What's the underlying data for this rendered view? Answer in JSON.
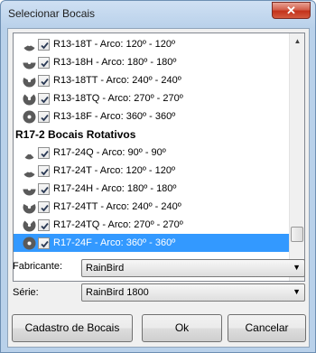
{
  "window": {
    "title": "Selecionar Bocais",
    "close_symbol": "✕"
  },
  "list": {
    "rows": [
      {
        "kind": "nozzle",
        "label": "R13-18T - Arco: 120º - 120º",
        "checked": true,
        "icon": "nozzle-120-icon"
      },
      {
        "kind": "nozzle",
        "label": "R13-18H - Arco: 180º - 180º",
        "checked": true,
        "icon": "nozzle-180-icon"
      },
      {
        "kind": "nozzle",
        "label": "R13-18TT - Arco: 240º - 240º",
        "checked": true,
        "icon": "nozzle-240-icon"
      },
      {
        "kind": "nozzle",
        "label": "R13-18TQ - Arco: 270º - 270º",
        "checked": true,
        "icon": "nozzle-270-icon"
      },
      {
        "kind": "nozzle",
        "label": "R13-18F - Arco: 360º - 360º",
        "checked": true,
        "icon": "nozzle-360-icon"
      },
      {
        "kind": "header",
        "label": "R17-2 Bocais Rotativos"
      },
      {
        "kind": "nozzle",
        "label": "R17-24Q - Arco: 90º - 90º",
        "checked": true,
        "icon": "nozzle-90-icon"
      },
      {
        "kind": "nozzle",
        "label": "R17-24T - Arco: 120º - 120º",
        "checked": true,
        "icon": "nozzle-120-icon"
      },
      {
        "kind": "nozzle",
        "label": "R17-24H - Arco: 180º - 180º",
        "checked": true,
        "icon": "nozzle-180-icon"
      },
      {
        "kind": "nozzle",
        "label": "R17-24TT - Arco: 240º - 240º",
        "checked": true,
        "icon": "nozzle-240-icon"
      },
      {
        "kind": "nozzle",
        "label": "R17-24TQ - Arco: 270º - 270º",
        "checked": true,
        "icon": "nozzle-270-icon"
      },
      {
        "kind": "nozzle",
        "label": "R17-24F - Arco: 360º - 360º",
        "checked": true,
        "icon": "nozzle-360-icon",
        "selected": true
      }
    ],
    "scroll_up_symbol": "▲",
    "scroll_down_symbol": "▼"
  },
  "fabricante": {
    "label": "Fabricante:",
    "value": "RainBird",
    "arrow": "▼"
  },
  "serie": {
    "label": "Série:",
    "value": "RainBird 1800",
    "arrow": "▼"
  },
  "buttons": {
    "cadastro": "Cadastro de Bocais",
    "ok": "Ok",
    "cancelar": "Cancelar"
  },
  "colors": {
    "selection": "#3399ff",
    "nozzle": "#5a5a5a"
  }
}
